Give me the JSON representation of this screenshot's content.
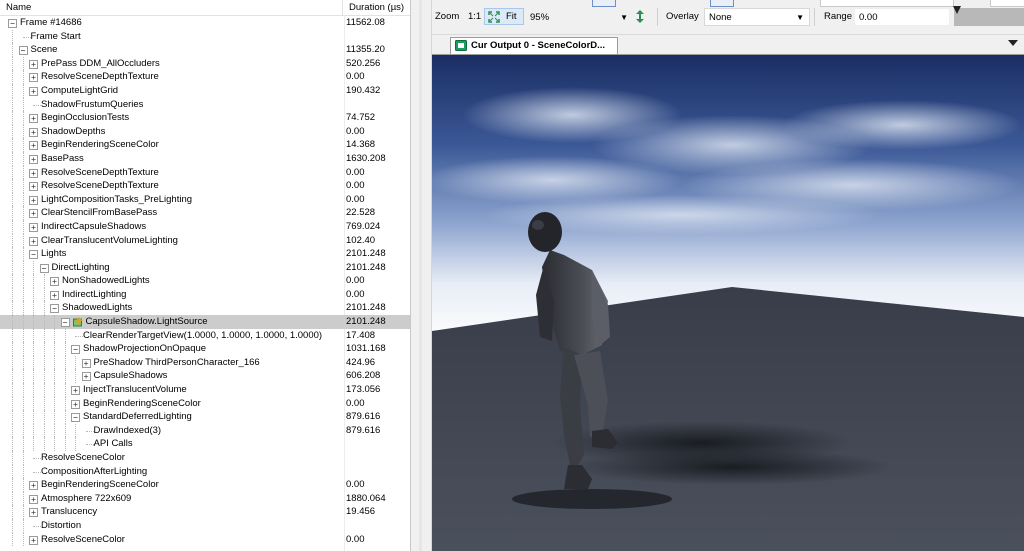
{
  "tree": {
    "columns": {
      "name": "Name",
      "duration": "Duration (µs)"
    },
    "rows": [
      {
        "depth": 0,
        "toggle": "minus",
        "label": "Frame #14686",
        "duration": "11562.08"
      },
      {
        "depth": 1,
        "toggle": "none",
        "label": "Frame Start",
        "duration": ""
      },
      {
        "depth": 1,
        "toggle": "minus",
        "label": "Scene",
        "duration": "11355.20"
      },
      {
        "depth": 2,
        "toggle": "plus",
        "label": "PrePass DDM_AllOccluders",
        "duration": "520.256"
      },
      {
        "depth": 2,
        "toggle": "plus",
        "label": "ResolveSceneDepthTexture",
        "duration": "0.00"
      },
      {
        "depth": 2,
        "toggle": "plus",
        "label": "ComputeLightGrid",
        "duration": "190.432"
      },
      {
        "depth": 2,
        "toggle": "none",
        "label": "ShadowFrustumQueries",
        "duration": ""
      },
      {
        "depth": 2,
        "toggle": "plus",
        "label": "BeginOcclusionTests",
        "duration": "74.752"
      },
      {
        "depth": 2,
        "toggle": "plus",
        "label": "ShadowDepths",
        "duration": "0.00"
      },
      {
        "depth": 2,
        "toggle": "plus",
        "label": "BeginRenderingSceneColor",
        "duration": "14.368"
      },
      {
        "depth": 2,
        "toggle": "plus",
        "label": "BasePass",
        "duration": "1630.208"
      },
      {
        "depth": 2,
        "toggle": "plus",
        "label": "ResolveSceneDepthTexture",
        "duration": "0.00"
      },
      {
        "depth": 2,
        "toggle": "plus",
        "label": "ResolveSceneDepthTexture",
        "duration": "0.00"
      },
      {
        "depth": 2,
        "toggle": "plus",
        "label": "LightCompositionTasks_PreLighting",
        "duration": "0.00"
      },
      {
        "depth": 2,
        "toggle": "plus",
        "label": "ClearStencilFromBasePass",
        "duration": "22.528"
      },
      {
        "depth": 2,
        "toggle": "plus",
        "label": "IndirectCapsuleShadows",
        "duration": "769.024"
      },
      {
        "depth": 2,
        "toggle": "plus",
        "label": "ClearTranslucentVolumeLighting",
        "duration": "102.40"
      },
      {
        "depth": 2,
        "toggle": "minus",
        "label": "Lights",
        "duration": "2101.248"
      },
      {
        "depth": 3,
        "toggle": "minus",
        "label": "DirectLighting",
        "duration": "2101.248"
      },
      {
        "depth": 4,
        "toggle": "plus",
        "label": "NonShadowedLights",
        "duration": "0.00"
      },
      {
        "depth": 4,
        "toggle": "plus",
        "label": "IndirectLighting",
        "duration": "0.00"
      },
      {
        "depth": 4,
        "toggle": "minus",
        "label": "ShadowedLights",
        "duration": "2101.248"
      },
      {
        "depth": 5,
        "toggle": "minus",
        "label": "CapsuleShadow.LightSource",
        "duration": "2101.248",
        "selected": true,
        "icon": "capture-icon"
      },
      {
        "depth": 6,
        "toggle": "none",
        "label": "ClearRenderTargetView(1.0000, 1.0000, 1.0000, 1.0000)",
        "duration": "17.408"
      },
      {
        "depth": 6,
        "toggle": "minus",
        "label": "ShadowProjectionOnOpaque",
        "duration": "1031.168"
      },
      {
        "depth": 7,
        "toggle": "plus",
        "label": "PreShadow ThirdPersonCharacter_166",
        "duration": "424.96"
      },
      {
        "depth": 7,
        "toggle": "plus",
        "label": "CapsuleShadows",
        "duration": "606.208"
      },
      {
        "depth": 6,
        "toggle": "plus",
        "label": "InjectTranslucentVolume",
        "duration": "173.056"
      },
      {
        "depth": 6,
        "toggle": "plus",
        "label": "BeginRenderingSceneColor",
        "duration": "0.00"
      },
      {
        "depth": 6,
        "toggle": "minus",
        "label": "StandardDeferredLighting",
        "duration": "879.616"
      },
      {
        "depth": 7,
        "toggle": "none",
        "label": "DrawIndexed(3)",
        "duration": "879.616"
      },
      {
        "depth": 7,
        "toggle": "none",
        "label": "API Calls",
        "duration": ""
      },
      {
        "depth": 2,
        "toggle": "none",
        "label": "ResolveSceneColor",
        "duration": ""
      },
      {
        "depth": 2,
        "toggle": "none",
        "label": "CompositionAfterLighting",
        "duration": ""
      },
      {
        "depth": 2,
        "toggle": "plus",
        "label": "BeginRenderingSceneColor",
        "duration": "0.00"
      },
      {
        "depth": 2,
        "toggle": "plus",
        "label": "Atmosphere 722x609",
        "duration": "1880.064"
      },
      {
        "depth": 2,
        "toggle": "plus",
        "label": "Translucency",
        "duration": "19.456"
      },
      {
        "depth": 2,
        "toggle": "none",
        "label": "Distortion",
        "duration": ""
      },
      {
        "depth": 2,
        "toggle": "plus",
        "label": "ResolveSceneColor",
        "duration": "0.00"
      }
    ]
  },
  "toolbar": {
    "zoom_label": "Zoom",
    "one_to_one": "1:1",
    "fit_label": "Fit",
    "zoom_value": "95%",
    "overlay_label": "Overlay",
    "overlay_value": "None",
    "range_label": "Range",
    "range_value": "0.00"
  },
  "tab": {
    "label": "Cur Output 0 - SceneColorD..."
  },
  "colors": {
    "selection": "#cccccc",
    "tab_icon": "#1a9e5a",
    "fit_icon": "#2e8b57"
  }
}
